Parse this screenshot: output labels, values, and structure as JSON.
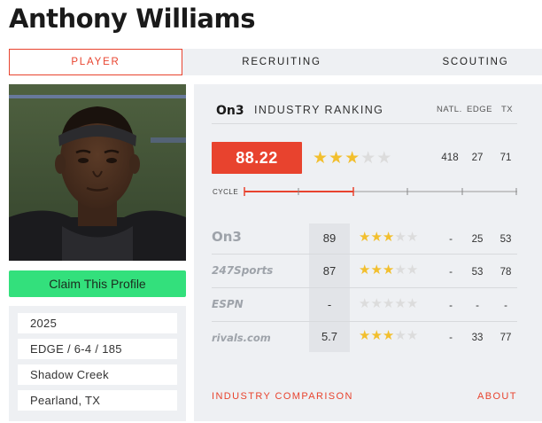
{
  "player": {
    "name": "Anthony Williams"
  },
  "tabs": [
    {
      "label": "PLAYER",
      "active": true
    },
    {
      "label": "RECRUITING",
      "active": false
    },
    {
      "label": "SCOUTING",
      "active": false
    }
  ],
  "claim_label": "Claim This Profile",
  "bio": [
    "2025",
    "EDGE / 6-4 / 185",
    "Shadow Creek",
    "Pearland, TX"
  ],
  "industry": {
    "brand": "On3",
    "title": "INDUSTRY RANKING",
    "columns": [
      "NATL.",
      "EDGE",
      "TX"
    ],
    "score": "88.22",
    "stars": 3,
    "natl": "418",
    "edge": "27",
    "tx": "71",
    "cycle_label": "CYCLE"
  },
  "services": [
    {
      "service": "On3",
      "rating": "89",
      "stars": 3,
      "natl": "-",
      "edge": "25",
      "tx": "53"
    },
    {
      "service": "247Sports",
      "rating": "87",
      "stars": 3,
      "natl": "-",
      "edge": "53",
      "tx": "78"
    },
    {
      "service": "ESPN",
      "rating": "-",
      "stars": 0,
      "natl": "-",
      "edge": "-",
      "tx": "-"
    },
    {
      "service": "rivals.com",
      "rating": "5.7",
      "stars": 3,
      "natl": "-",
      "edge": "33",
      "tx": "77"
    }
  ],
  "links": {
    "comparison": "INDUSTRY COMPARISON",
    "about": "ABOUT"
  },
  "colors": {
    "accent": "#e8432e",
    "star": "#f2bf2e",
    "claim": "#33e07c"
  }
}
